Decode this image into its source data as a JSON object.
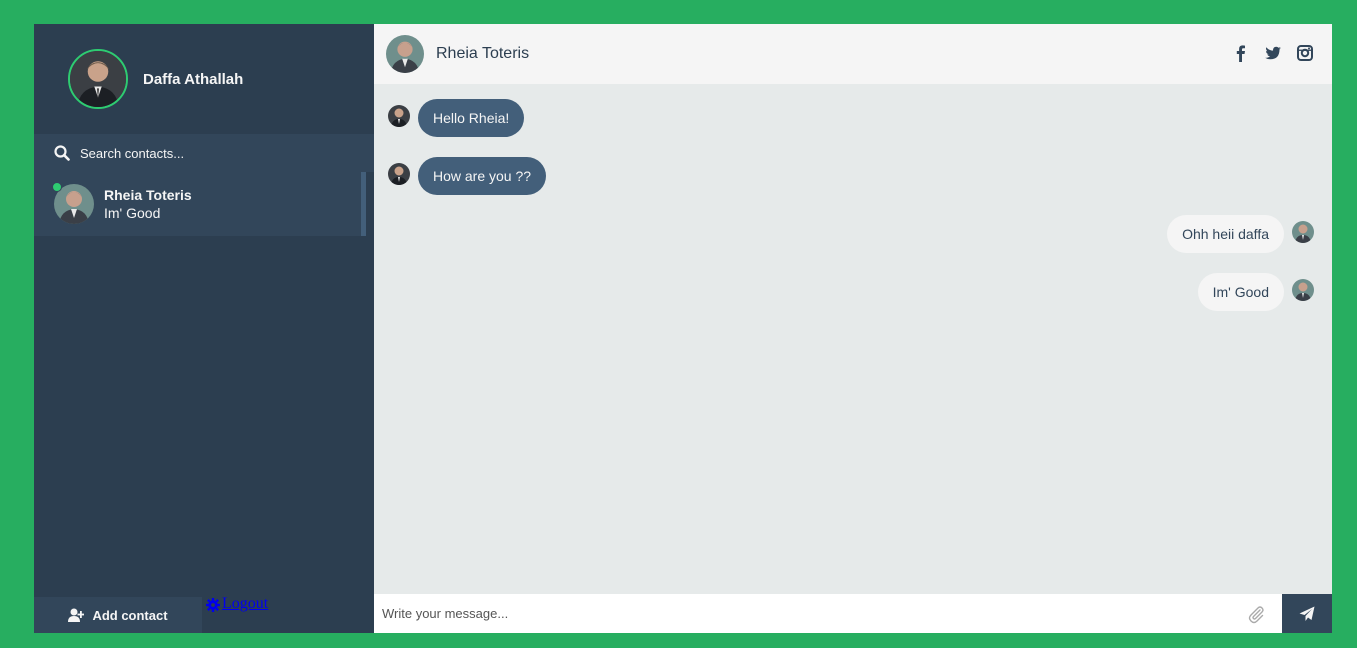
{
  "colors": {
    "background": "#27ae60",
    "sidebar": "#2c3e50",
    "sidebar_accent": "#32465a",
    "online": "#2ecc71",
    "sent_bubble": "#435f7a",
    "chat_background": "#e6eaea"
  },
  "profile": {
    "name": "Daffa Athallah",
    "avatar_icon": "user-avatar"
  },
  "search": {
    "icon": "search-icon",
    "placeholder": "Search contacts..."
  },
  "contacts": [
    {
      "name": "Rheia Toteris",
      "preview": "Im' Good",
      "status": "online",
      "active": true
    }
  ],
  "sidebar_bottom": {
    "add_contact_label": "Add contact",
    "add_contact_icon": "user-plus-icon",
    "logout_label": "Logout",
    "logout_icon": "gear-icon"
  },
  "chat_header": {
    "name": "Rheia Toteris",
    "social_icons": [
      "facebook-icon",
      "twitter-icon",
      "instagram-icon"
    ]
  },
  "messages": [
    {
      "type": "sent",
      "text": "Hello Rheia!"
    },
    {
      "type": "sent",
      "text": "How are you ??"
    },
    {
      "type": "replies",
      "text": "Ohh heii daffa"
    },
    {
      "type": "replies",
      "text": "Im' Good"
    }
  ],
  "composer": {
    "placeholder": "Write your message...",
    "attach_icon": "paperclip-icon",
    "send_icon": "paper-plane-icon"
  }
}
